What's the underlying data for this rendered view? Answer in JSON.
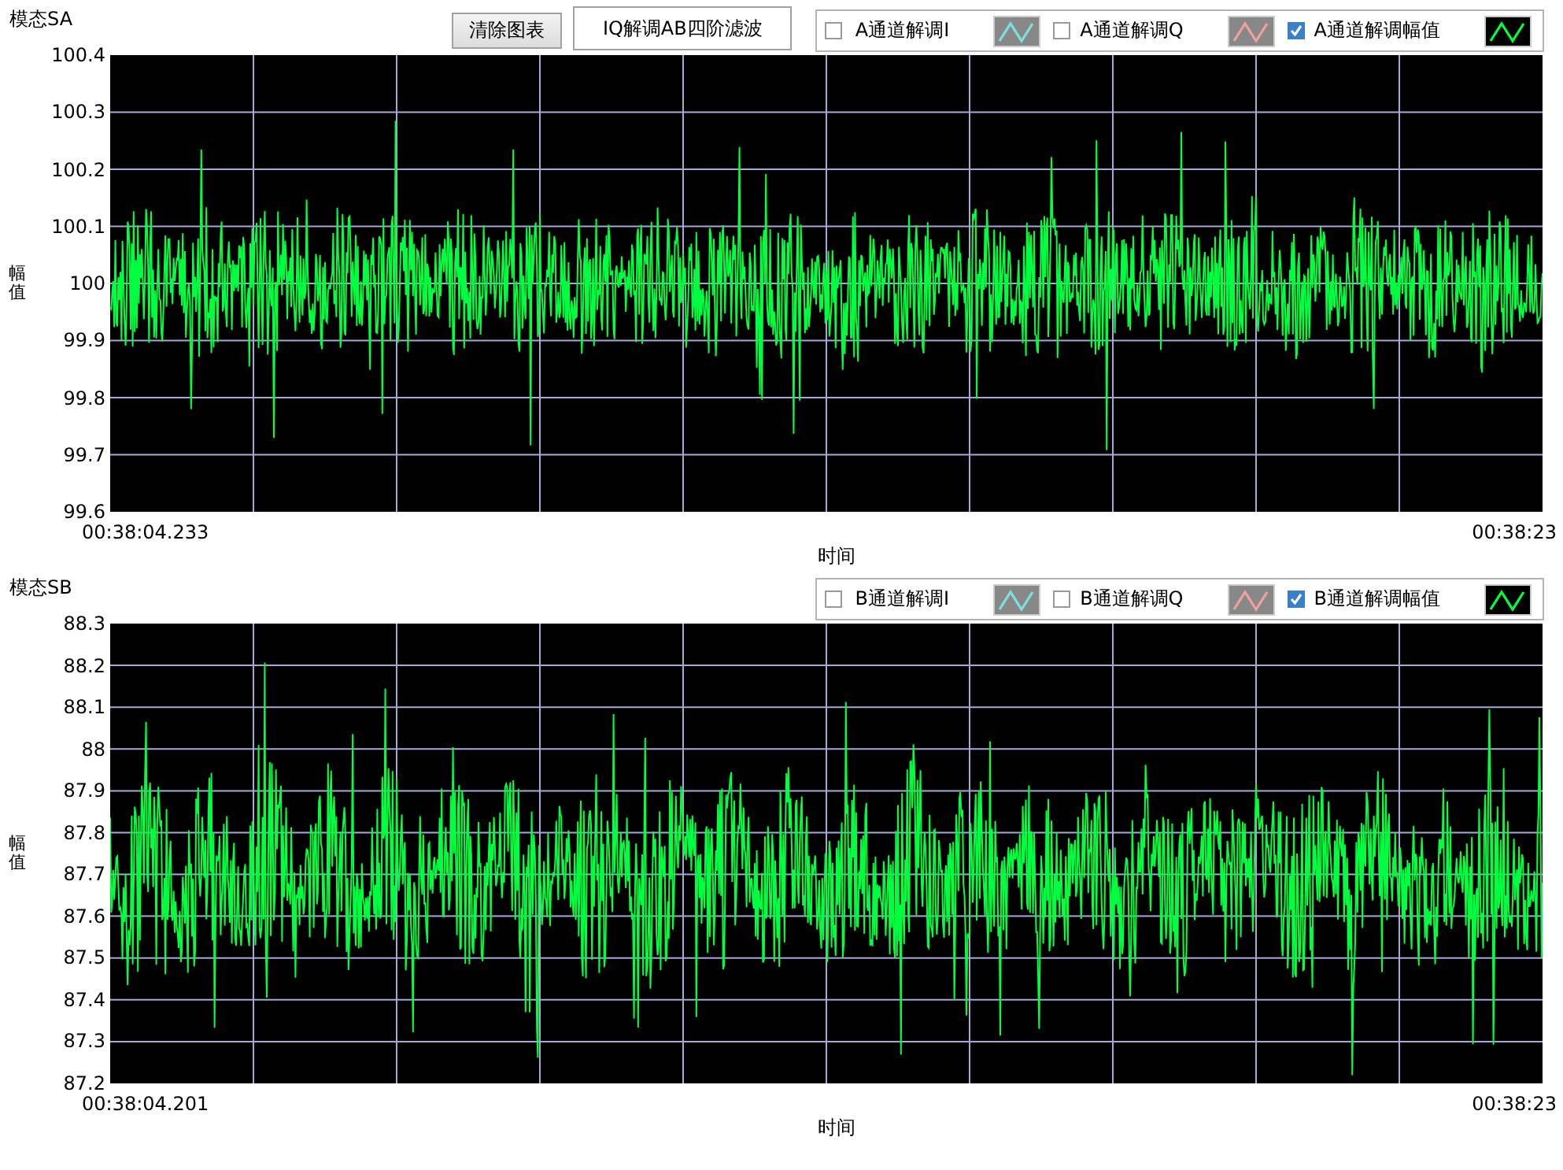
{
  "charts": [
    {
      "title": "模态SA",
      "buttons": [
        {
          "kind": "push",
          "label": "清除图表"
        },
        {
          "kind": "display",
          "label": "IQ解调AB四阶滤波"
        }
      ],
      "legend": [
        {
          "label": "A通道解调I",
          "checked": false,
          "color": "#80e0e0"
        },
        {
          "label": "A通道解调Q",
          "checked": false,
          "color": "#f0a0a0"
        },
        {
          "label": "A通道解调幅值",
          "checked": true,
          "color": "#00ff40"
        }
      ],
      "ylabel": "幅值",
      "yticks": [
        "100.4",
        "100.3",
        "100.2",
        "100.1",
        "100",
        "99.9",
        "99.8",
        "99.7",
        "99.6"
      ],
      "x_start": "00:38:04.233",
      "x_end": "00:38:23",
      "xlabel": "时间"
    },
    {
      "title": "模态SB",
      "legend": [
        {
          "label": "B通道解调I",
          "checked": false,
          "color": "#80e0e0"
        },
        {
          "label": "B通道解调Q",
          "checked": false,
          "color": "#f0a0a0"
        },
        {
          "label": "B通道解调幅值",
          "checked": true,
          "color": "#00ff40"
        }
      ],
      "ylabel": "幅值",
      "yticks": [
        "88.3",
        "88.2",
        "88.1",
        "88",
        "87.9",
        "87.8",
        "87.7",
        "87.6",
        "87.5",
        "87.4",
        "87.3",
        "87.2"
      ],
      "x_start": "00:38:04.201",
      "x_end": "00:38:23",
      "xlabel": "时间"
    }
  ]
}
